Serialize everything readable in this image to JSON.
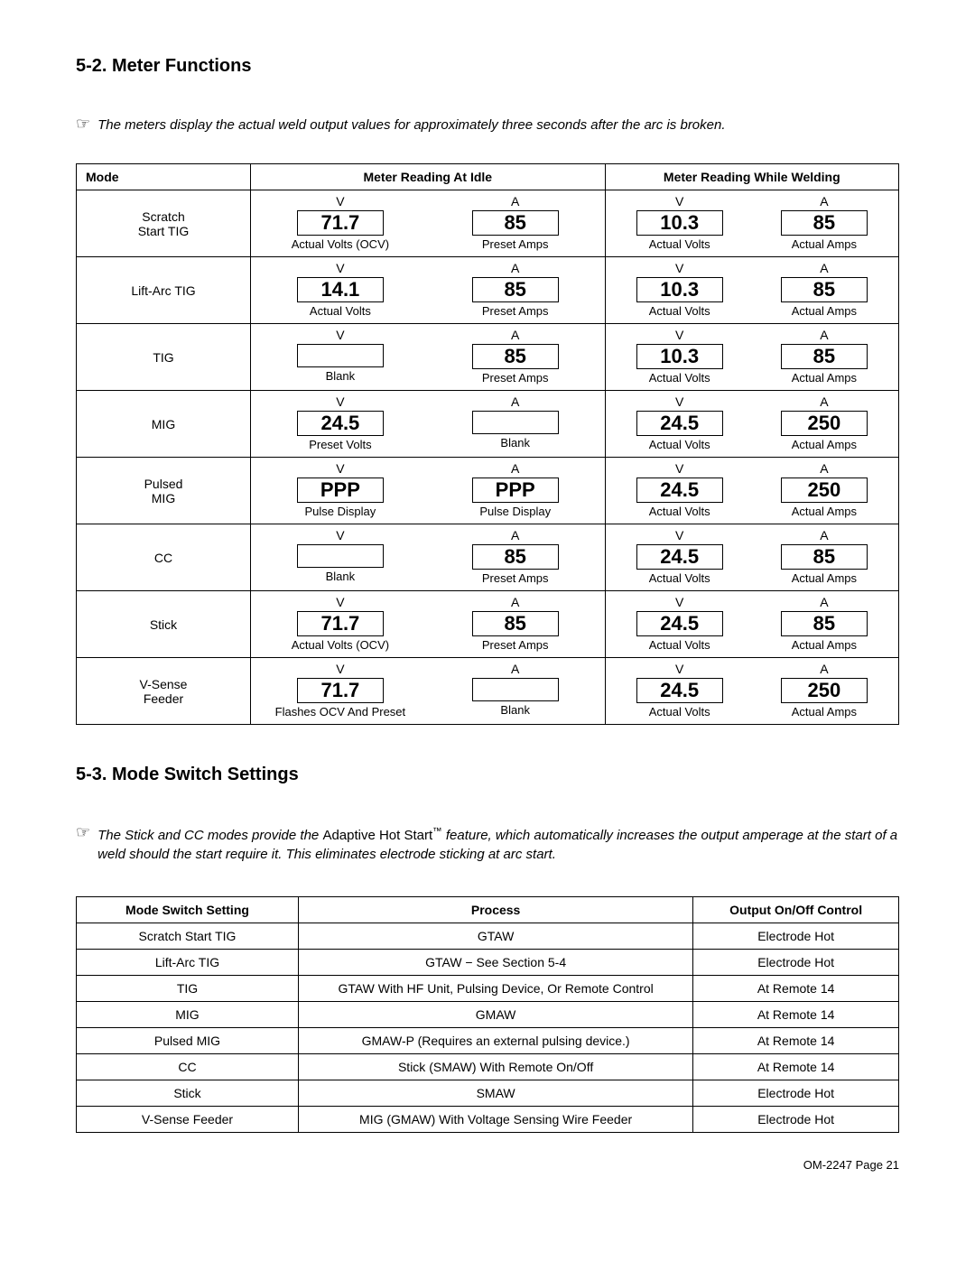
{
  "section1": {
    "heading": "5-2.   Meter Functions",
    "note": "The meters display the actual weld output values for approximately three seconds after the arc is broken.",
    "cols": {
      "mode": "Mode",
      "idle": "Meter Reading At Idle",
      "weld": "Meter Reading While Welding"
    },
    "labels": {
      "V": "V",
      "A": "A"
    },
    "rows": [
      {
        "mode_lines": [
          "Scratch",
          "Start TIG"
        ],
        "idle": [
          {
            "top": "V",
            "val": "71.7",
            "bot": "Actual Volts (OCV)"
          },
          {
            "top": "A",
            "val": "85",
            "bot": "Preset Amps"
          }
        ],
        "weld": [
          {
            "top": "V",
            "val": "10.3",
            "bot": "Actual Volts"
          },
          {
            "top": "A",
            "val": "85",
            "bot": "Actual Amps"
          }
        ]
      },
      {
        "mode_lines": [
          "Lift-Arc TIG"
        ],
        "idle": [
          {
            "top": "V",
            "val": "14.1",
            "bot": "Actual Volts"
          },
          {
            "top": "A",
            "val": "85",
            "bot": "Preset Amps"
          }
        ],
        "weld": [
          {
            "top": "V",
            "val": "10.3",
            "bot": "Actual Volts"
          },
          {
            "top": "A",
            "val": "85",
            "bot": "Actual Amps"
          }
        ]
      },
      {
        "mode_lines": [
          "TIG"
        ],
        "idle": [
          {
            "top": "V",
            "val": "",
            "bot": "Blank"
          },
          {
            "top": "A",
            "val": "85",
            "bot": "Preset Amps"
          }
        ],
        "weld": [
          {
            "top": "V",
            "val": "10.3",
            "bot": "Actual Volts"
          },
          {
            "top": "A",
            "val": "85",
            "bot": "Actual Amps"
          }
        ]
      },
      {
        "mode_lines": [
          "MIG"
        ],
        "idle": [
          {
            "top": "V",
            "val": "24.5",
            "bot": "Preset Volts"
          },
          {
            "top": "A",
            "val": "",
            "bot": "Blank"
          }
        ],
        "weld": [
          {
            "top": "V",
            "val": "24.5",
            "bot": "Actual Volts"
          },
          {
            "top": "A",
            "val": "250",
            "bot": "Actual Amps"
          }
        ]
      },
      {
        "mode_lines": [
          "Pulsed",
          "MIG"
        ],
        "idle": [
          {
            "top": "V",
            "val": "PPP",
            "bot": "Pulse Display"
          },
          {
            "top": "A",
            "val": "PPP",
            "bot": "Pulse Display"
          }
        ],
        "weld": [
          {
            "top": "V",
            "val": "24.5",
            "bot": "Actual Volts"
          },
          {
            "top": "A",
            "val": "250",
            "bot": "Actual Amps"
          }
        ]
      },
      {
        "mode_lines": [
          "CC"
        ],
        "idle": [
          {
            "top": "V",
            "val": "",
            "bot": "Blank"
          },
          {
            "top": "A",
            "val": "85",
            "bot": "Preset Amps"
          }
        ],
        "weld": [
          {
            "top": "V",
            "val": "24.5",
            "bot": "Actual Volts"
          },
          {
            "top": "A",
            "val": "85",
            "bot": "Actual Amps"
          }
        ]
      },
      {
        "mode_lines": [
          "Stick"
        ],
        "idle": [
          {
            "top": "V",
            "val": "71.7",
            "bot": "Actual Volts (OCV)"
          },
          {
            "top": "A",
            "val": "85",
            "bot": "Preset Amps"
          }
        ],
        "weld": [
          {
            "top": "V",
            "val": "24.5",
            "bot": "Actual Volts"
          },
          {
            "top": "A",
            "val": "85",
            "bot": "Actual Amps"
          }
        ]
      },
      {
        "mode_lines": [
          "V-Sense",
          "Feeder"
        ],
        "idle": [
          {
            "top": "V",
            "val": "71.7",
            "bot": "Flashes OCV And Preset"
          },
          {
            "top": "A",
            "val": "",
            "bot": "Blank"
          }
        ],
        "weld": [
          {
            "top": "V",
            "val": "24.5",
            "bot": "Actual Volts"
          },
          {
            "top": "A",
            "val": "250",
            "bot": "Actual Amps"
          }
        ]
      }
    ]
  },
  "section2": {
    "heading": "5-3.   Mode Switch Settings",
    "note_pre": "The Stick and CC modes provide the ",
    "note_mid": "Adaptive Hot Start",
    "note_tm": "™",
    "note_post": " feature, which automatically increases the output amperage at the start of a weld should the start require it. This eliminates electrode sticking at arc start.",
    "cols": {
      "mode": "Mode Switch Setting",
      "process": "Process",
      "control": "Output On/Off Control"
    },
    "rows": [
      {
        "mode": "Scratch Start TIG",
        "process": "GTAW",
        "control": "Electrode Hot"
      },
      {
        "mode": "Lift-Arc TIG",
        "process": "GTAW − See Section 5-4",
        "control": "Electrode Hot"
      },
      {
        "mode": "TIG",
        "process": "GTAW With HF Unit, Pulsing Device, Or Remote Control",
        "control": "At Remote 14"
      },
      {
        "mode": "MIG",
        "process": "GMAW",
        "control": "At Remote 14"
      },
      {
        "mode": "Pulsed MIG",
        "process": "GMAW-P (Requires an external pulsing device.)",
        "control": "At Remote 14"
      },
      {
        "mode": "CC",
        "process": "Stick (SMAW) With Remote On/Off",
        "control": "At Remote 14"
      },
      {
        "mode": "Stick",
        "process": "SMAW",
        "control": "Electrode Hot"
      },
      {
        "mode": "V-Sense Feeder",
        "process": "MIG (GMAW) With Voltage Sensing Wire Feeder",
        "control": "Electrode Hot"
      }
    ]
  },
  "footer": "OM-2247 Page 21"
}
